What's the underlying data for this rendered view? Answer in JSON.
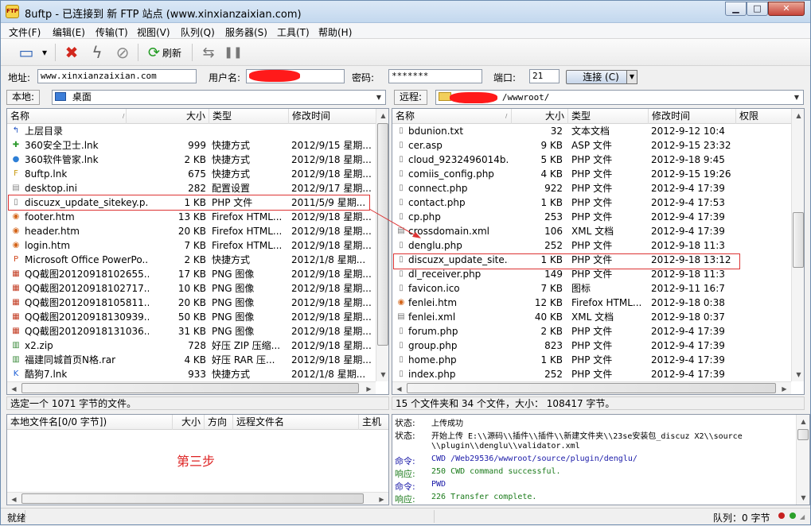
{
  "window": {
    "app_icon_label": "FTP",
    "title": "8uftp - 已连接到 新 FTP 站点 (www.xinxianzaixian.com)",
    "min_glyph": "▁",
    "max_glyph": "□",
    "close_glyph": "✕"
  },
  "menu": [
    "文件(F)",
    "编辑(E)",
    "传输(T)",
    "视图(V)",
    "队列(Q)",
    "服务器(S)",
    "工具(T)",
    "帮助(H)"
  ],
  "toolbar": {
    "refresh_label": "刷新",
    "icons": {
      "site_manager": "▭",
      "dropdown": "▾",
      "disconnect": "✖",
      "quick": "ϟ",
      "stop": "⊘",
      "refresh": "⟳",
      "transfer": "⇆",
      "pause": "❚❚"
    }
  },
  "connection": {
    "address_label": "地址:",
    "address_value": "www.xinxianzaixian.com",
    "user_label": "用户名:",
    "user_value": "",
    "password_label": "密码:",
    "password_value": "*******",
    "port_label": "端口:",
    "port_value": "21",
    "connect_label": "连接 (C)"
  },
  "local": {
    "label": "本地:",
    "path": "桌面",
    "columns": [
      "名称",
      "大小",
      "类型",
      "修改时间"
    ],
    "files": [
      {
        "name": "上层目录",
        "size": "",
        "type": "",
        "date": "",
        "icon": "↰",
        "color": "#1a4fc2"
      },
      {
        "name": "360安全卫士.lnk",
        "size": "999",
        "type": "快捷方式",
        "date": "2012/9/15 星期...",
        "icon": "✚",
        "color": "#2e9a2e"
      },
      {
        "name": "360软件管家.lnk",
        "size": "2 KB",
        "type": "快捷方式",
        "date": "2012/9/18 星期...",
        "icon": "●",
        "color": "#2e7fd6"
      },
      {
        "name": "8uftp.lnk",
        "size": "675",
        "type": "快捷方式",
        "date": "2012/9/18 星期...",
        "icon": "F",
        "color": "#c99a10"
      },
      {
        "name": "desktop.ini",
        "size": "282",
        "type": "配置设置",
        "date": "2012/9/17 星期...",
        "icon": "▤",
        "color": "#888888"
      },
      {
        "name": "discuzx_update_sitekey.p...",
        "size": "1 KB",
        "type": "PHP 文件",
        "date": "2011/5/9 星期...",
        "icon": "▯",
        "color": "#777777"
      },
      {
        "name": "footer.htm",
        "size": "13 KB",
        "type": "Firefox HTML...",
        "date": "2012/9/18 星期...",
        "icon": "◉",
        "color": "#d4651a"
      },
      {
        "name": "header.htm",
        "size": "20 KB",
        "type": "Firefox HTML...",
        "date": "2012/9/18 星期...",
        "icon": "◉",
        "color": "#d4651a"
      },
      {
        "name": "login.htm",
        "size": "7 KB",
        "type": "Firefox HTML...",
        "date": "2012/9/18 星期...",
        "icon": "◉",
        "color": "#d4651a"
      },
      {
        "name": "Microsoft Office PowerPo...",
        "size": "2 KB",
        "type": "快捷方式",
        "date": "2012/1/8 星期...",
        "icon": "P",
        "color": "#d2491f"
      },
      {
        "name": "QQ截图20120918102655....",
        "size": "17 KB",
        "type": "PNG 图像",
        "date": "2012/9/18 星期...",
        "icon": "▦",
        "color": "#c23a20"
      },
      {
        "name": "QQ截图20120918102717....",
        "size": "10 KB",
        "type": "PNG 图像",
        "date": "2012/9/18 星期...",
        "icon": "▦",
        "color": "#c23a20"
      },
      {
        "name": "QQ截图20120918105811....",
        "size": "20 KB",
        "type": "PNG 图像",
        "date": "2012/9/18 星期...",
        "icon": "▦",
        "color": "#c23a20"
      },
      {
        "name": "QQ截图20120918130939....",
        "size": "50 KB",
        "type": "PNG 图像",
        "date": "2012/9/18 星期...",
        "icon": "▦",
        "color": "#c23a20"
      },
      {
        "name": "QQ截图20120918131036....",
        "size": "31 KB",
        "type": "PNG 图像",
        "date": "2012/9/18 星期...",
        "icon": "▦",
        "color": "#c23a20"
      },
      {
        "name": "x2.zip",
        "size": "728",
        "type": "好压 ZIP 压缩...",
        "date": "2012/9/18 星期...",
        "icon": "▥",
        "color": "#3a8a3a"
      },
      {
        "name": "福建同城首页N格.rar",
        "size": "4 KB",
        "type": "好压 RAR 压...",
        "date": "2012/9/18 星期...",
        "icon": "▥",
        "color": "#3a8a3a"
      },
      {
        "name": "酷狗7.lnk",
        "size": "933",
        "type": "快捷方式",
        "date": "2012/1/8 星期...",
        "icon": "K",
        "color": "#1d5fd6"
      }
    ],
    "status": "选定一个 1071 字节的文件。"
  },
  "remote": {
    "label": "远程:",
    "path": "/wwwroot/",
    "columns": [
      "名称",
      "大小",
      "类型",
      "修改时间",
      "权限"
    ],
    "files": [
      {
        "name": "bdunion.txt",
        "size": "32",
        "type": "文本文档",
        "date": "2012-9-12 10:4",
        "icon": "▯",
        "color": "#777777"
      },
      {
        "name": "cer.asp",
        "size": "9 KB",
        "type": "ASP 文件",
        "date": "2012-9-15 23:32",
        "icon": "▯",
        "color": "#777777"
      },
      {
        "name": "cloud_9232496014b...",
        "size": "5 KB",
        "type": "PHP 文件",
        "date": "2012-9-18 9:45",
        "icon": "▯",
        "color": "#777777"
      },
      {
        "name": "comiis_config.php",
        "size": "4 KB",
        "type": "PHP 文件",
        "date": "2012-9-15 19:26",
        "icon": "▯",
        "color": "#777777"
      },
      {
        "name": "connect.php",
        "size": "922",
        "type": "PHP 文件",
        "date": "2012-9-4 17:39",
        "icon": "▯",
        "color": "#777777"
      },
      {
        "name": "contact.php",
        "size": "1 KB",
        "type": "PHP 文件",
        "date": "2012-9-4 17:53",
        "icon": "▯",
        "color": "#777777"
      },
      {
        "name": "cp.php",
        "size": "253",
        "type": "PHP 文件",
        "date": "2012-9-4 17:39",
        "icon": "▯",
        "color": "#777777"
      },
      {
        "name": "crossdomain.xml",
        "size": "106",
        "type": "XML 文档",
        "date": "2012-9-4 17:39",
        "icon": "▤",
        "color": "#777777"
      },
      {
        "name": "denglu.php",
        "size": "252",
        "type": "PHP 文件",
        "date": "2012-9-18 11:3",
        "icon": "▯",
        "color": "#777777"
      },
      {
        "name": "discuzx_update_site...",
        "size": "1 KB",
        "type": "PHP 文件",
        "date": "2012-9-18 13:12",
        "icon": "▯",
        "color": "#777777"
      },
      {
        "name": "dl_receiver.php",
        "size": "149",
        "type": "PHP 文件",
        "date": "2012-9-18 11:3",
        "icon": "▯",
        "color": "#777777"
      },
      {
        "name": "favicon.ico",
        "size": "7 KB",
        "type": "图标",
        "date": "2012-9-11 16:7",
        "icon": "▯",
        "color": "#777777"
      },
      {
        "name": "fenlei.htm",
        "size": "12 KB",
        "type": "Firefox HTML...",
        "date": "2012-9-18 0:38",
        "icon": "◉",
        "color": "#d4651a"
      },
      {
        "name": "fenlei.xml",
        "size": "40 KB",
        "type": "XML 文档",
        "date": "2012-9-18 0:37",
        "icon": "▤",
        "color": "#777777"
      },
      {
        "name": "forum.php",
        "size": "2 KB",
        "type": "PHP 文件",
        "date": "2012-9-4 17:39",
        "icon": "▯",
        "color": "#777777"
      },
      {
        "name": "group.php",
        "size": "823",
        "type": "PHP 文件",
        "date": "2012-9-4 17:39",
        "icon": "▯",
        "color": "#777777"
      },
      {
        "name": "home.php",
        "size": "1 KB",
        "type": "PHP 文件",
        "date": "2012-9-4 17:39",
        "icon": "▯",
        "color": "#777777"
      },
      {
        "name": "index.php",
        "size": "252",
        "type": "PHP 文件",
        "date": "2012-9-4 17:39",
        "icon": "▯",
        "color": "#777777"
      }
    ],
    "status": "15 个文件夹和 34 个文件，大小： 108417 字节。"
  },
  "queue": {
    "columns": [
      "本地文件名[0/0 字节])",
      "大小",
      "方向",
      "远程文件名",
      "主机"
    ],
    "annotation": "第三步"
  },
  "log": [
    {
      "label": "状态:",
      "msg": "上传成功",
      "color": "#000000"
    },
    {
      "label": "状态:",
      "msg": "开始上传 E:\\\\源码\\\\插件\\\\插件\\\\新建文件夹\\\\23se安装包_discuz X2\\\\source",
      "color": "#000000"
    },
    {
      "label": "",
      "msg": "\\\\plugin\\\\denglu\\\\validator.xml",
      "color": "#000000"
    },
    {
      "label": "命令:",
      "msg": "CWD /Web29536/wwwroot/source/plugin/denglu/",
      "color": "#1a1aa8"
    },
    {
      "label": "响应:",
      "msg": "250 CWD command successful.",
      "color": "#1a7a1a"
    },
    {
      "label": "命令:",
      "msg": "PWD",
      "color": "#1a1aa8"
    },
    {
      "label": "响应:",
      "msg": "226 Transfer complete.",
      "color": "#1a7a1a"
    }
  ],
  "statusbar": {
    "ready": "就绪",
    "queue": "队列：0 字节"
  },
  "colors": {
    "highlight": "#dd3333",
    "annotation": "#dd2222"
  }
}
